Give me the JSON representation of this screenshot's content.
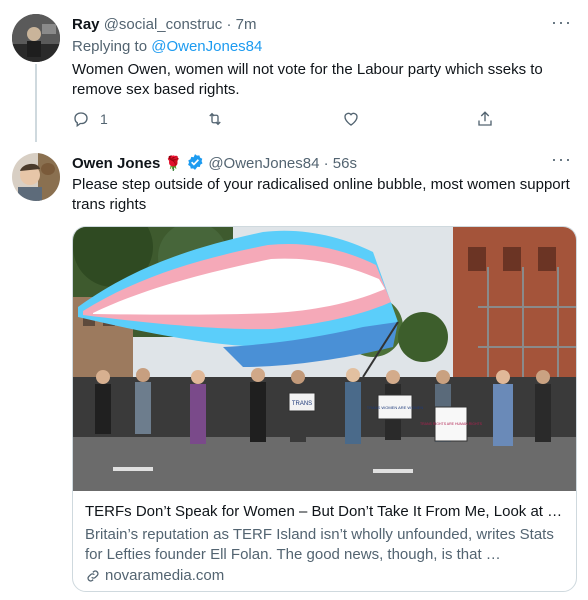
{
  "reply_tweet": {
    "display_name": "Ray",
    "handle": "@social_construc",
    "separator": "·",
    "time": "7m",
    "replying_prefix": "Replying to",
    "replying_handle": "@OwenJones84",
    "text": "Women Owen, women will not vote for the Labour party which sseks to remove sex based rights.",
    "reply_count": "1",
    "more_icon": "more-dots-icon"
  },
  "main_tweet": {
    "display_name": "Owen Jones",
    "emoji": "🌹",
    "handle": "@OwenJones84",
    "separator": "·",
    "time": "56s",
    "text": "Please step outside of your radicalised online bubble, most women support trans rights",
    "card": {
      "title": "TERFs Don’t Speak for Women – But Don’t Take It From Me, Look at …",
      "description": "Britain’s reputation as TERF Island isn’t wholly unfounded, writes Stats for Lefties founder Ell Folan. The good news, though, is that …",
      "domain": "novaramedia.com",
      "image_description_icon": "protest-photo",
      "signs": [
        "TRANS",
        "TRANS WOMEN ARE WOMEN",
        "TRANS RIGHTS ARE HUMAN RIGHTS"
      ]
    }
  },
  "colors": {
    "accent": "#1d9bf0",
    "muted": "#536471",
    "flag_blue": "#5bcefa",
    "flag_pink": "#f5a9b8"
  }
}
